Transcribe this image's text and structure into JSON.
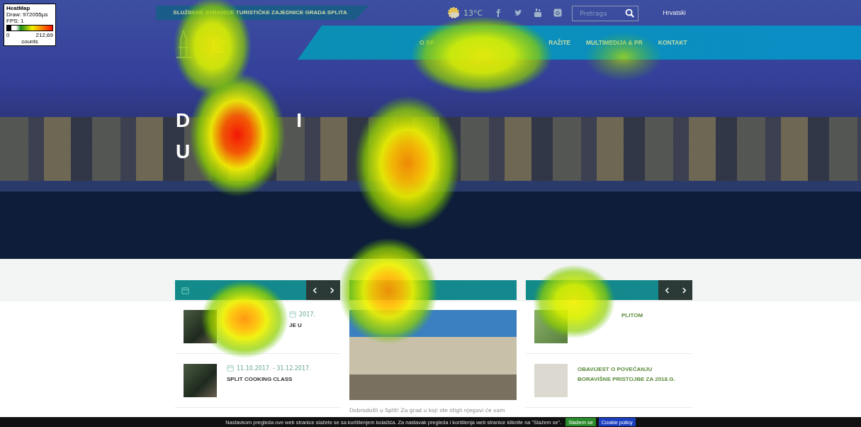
{
  "heatmap_legend": {
    "title": "HeatMap",
    "draw": "Draw: 972055µs",
    "fps": "FPS: 1",
    "min": "0",
    "max": "212,69",
    "unit": "counts"
  },
  "top_bar": {
    "tagline": "SLUŽBENE STRANICE TURISTIČKE ZAJEDNICE GRADA SPLITA",
    "temperature": "13°C",
    "search": {
      "placeholder": "Pretraga"
    },
    "language": "Hrvatski"
  },
  "nav": [
    "O SP",
    "RAŽITE",
    "MULTIMEDIJA & PR",
    "KONTAKT"
  ],
  "hero": {
    "fragments": [
      "D",
      "I",
      "U"
    ]
  },
  "events": {
    "items": [
      {
        "date": "2017.",
        "title": "JE U"
      },
      {
        "date": "11.10.2017. - 31.12.2017.",
        "title": "SPLIT COOKING CLASS"
      }
    ]
  },
  "welcome": {
    "text": "Dobrodošli u Split! Za grad u koji ste stigli njegovi će vam"
  },
  "news": {
    "items": [
      {
        "title": "PLITOM"
      },
      {
        "title": "OBAVIJEST O POVEĆANJU BORAVIŠNE PRISTOJBE ZA 2018.G."
      }
    ]
  },
  "cookie_bar": {
    "text": "Nastavkom pregleda ove web stranice slažete se sa korištenjem kolačića. Za nastavak pregleda i korištenja web stranice kliknite na \"Slažem se\".",
    "buttons": [
      {
        "label": "Slažem se",
        "kind": "accept"
      },
      {
        "label": "Cookie policy",
        "kind": "policy"
      }
    ]
  }
}
